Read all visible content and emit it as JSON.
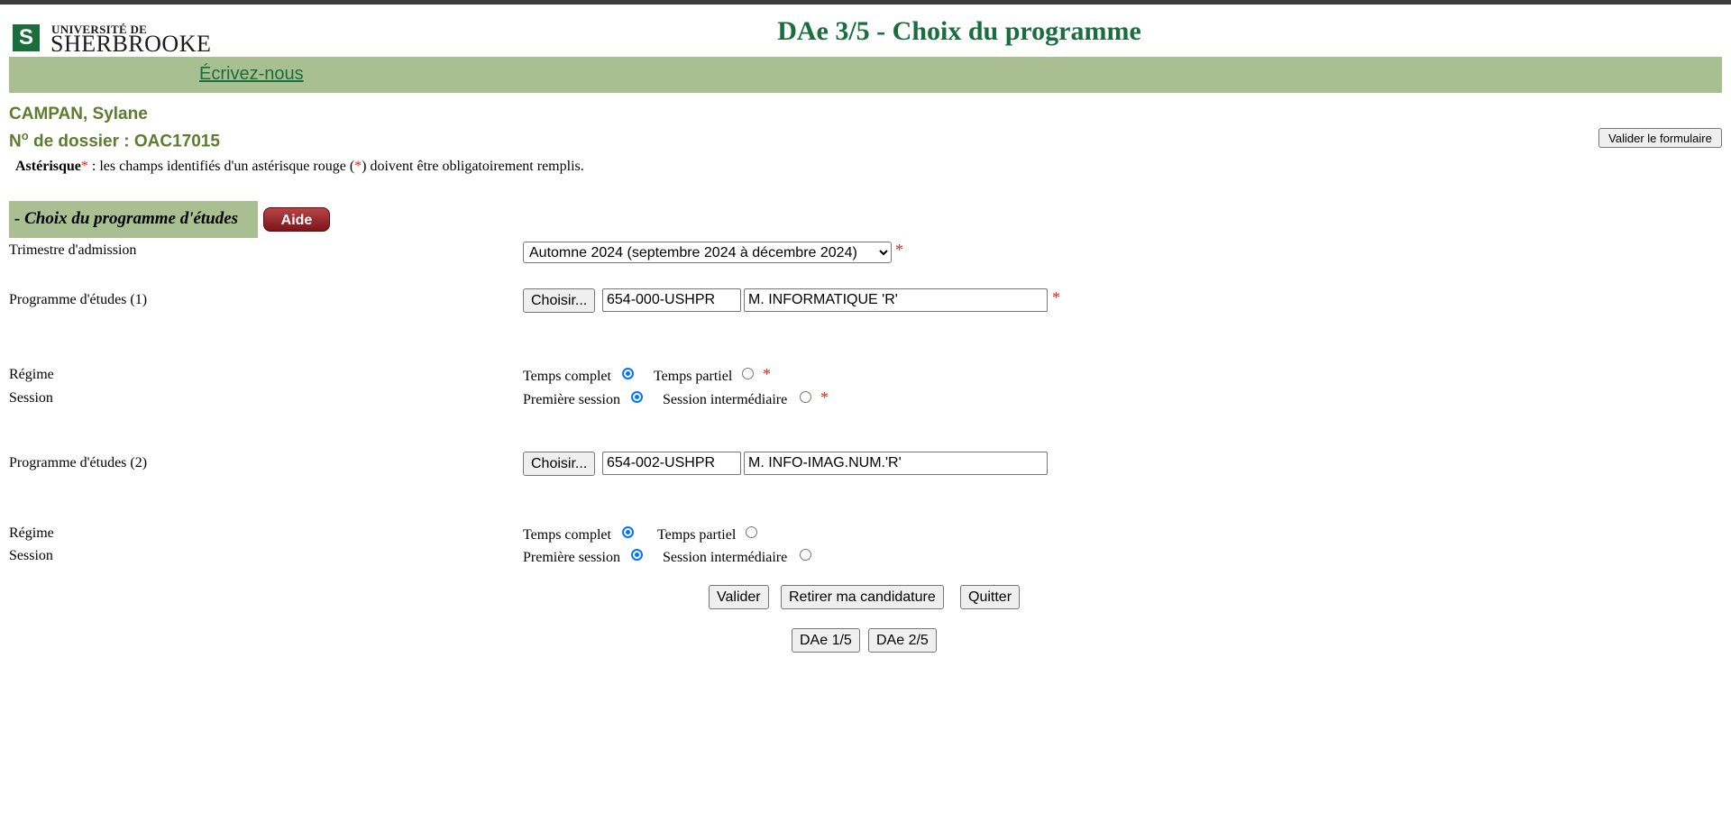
{
  "header": {
    "logo_small": "UNIVERSITÉ DE",
    "logo_big": "SHERBROOKE",
    "title": "DAe 3/5 - Choix du programme",
    "nav_link": "Écrivez-nous"
  },
  "applicant": {
    "name": "CAMPAN, Sylane",
    "dossier_prefix": "N",
    "dossier_sup": "o",
    "dossier_label": " de dossier : OAC17015"
  },
  "validate_form_label": "Valider le formulaire",
  "note": {
    "bold": "Astérisque",
    "star": "*",
    "text1": " : les champs identifiés d'un astérisque rouge (",
    "text2": ") doivent être obligatoirement remplis."
  },
  "section": {
    "title": "- Choix du programme d'études",
    "help_label": "Aide"
  },
  "form": {
    "trimestre_label": "Trimestre d'admission",
    "trimestre_value": "Automne 2024 (septembre 2024 à décembre 2024)",
    "star": "*",
    "choose_label": "Choisir...",
    "program1": {
      "label": "Programme d'études (1)",
      "code": "654-000-USHPR",
      "name": "M. INFORMATIQUE 'R'",
      "regime_label": "Régime",
      "session_label": "Session",
      "full_time": "Temps complet",
      "part_time": "Temps partiel",
      "first_session": "Première session",
      "intermediate_session": "Session intermédiaire"
    },
    "program2": {
      "label": "Programme d'études (2)",
      "code": "654-002-USHPR",
      "name": "M. INFO-IMAG.NUM.'R'",
      "regime_label": "Régime",
      "session_label": "Session",
      "full_time": "Temps complet",
      "part_time": "Temps partiel",
      "first_session": "Première session",
      "intermediate_session": "Session intermédiaire"
    }
  },
  "actions": {
    "validate": "Valider",
    "withdraw": "Retirer ma candidature",
    "quit": "Quitter",
    "step1": "DAe 1/5",
    "step2": "DAe 2/5"
  }
}
